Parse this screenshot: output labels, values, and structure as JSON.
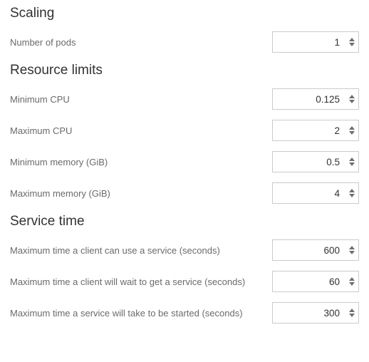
{
  "sections": {
    "scaling": {
      "heading": "Scaling",
      "number_of_pods": {
        "label": "Number of pods",
        "value": "1"
      }
    },
    "resource_limits": {
      "heading": "Resource limits",
      "min_cpu": {
        "label": "Minimum CPU",
        "value": "0.125"
      },
      "max_cpu": {
        "label": "Maximum CPU",
        "value": "2"
      },
      "min_mem": {
        "label": "Minimum memory (GiB)",
        "value": "0.5"
      },
      "max_mem": {
        "label": "Maximum memory (GiB)",
        "value": "4"
      }
    },
    "service_time": {
      "heading": "Service time",
      "max_use": {
        "label": "Maximum time a client can use a service (seconds)",
        "value": "600"
      },
      "max_wait": {
        "label": "Maximum time a client will wait to get a service (seconds)",
        "value": "60"
      },
      "max_start": {
        "label": "Maximum time a service will take to be started (seconds)",
        "value": "300"
      }
    }
  }
}
